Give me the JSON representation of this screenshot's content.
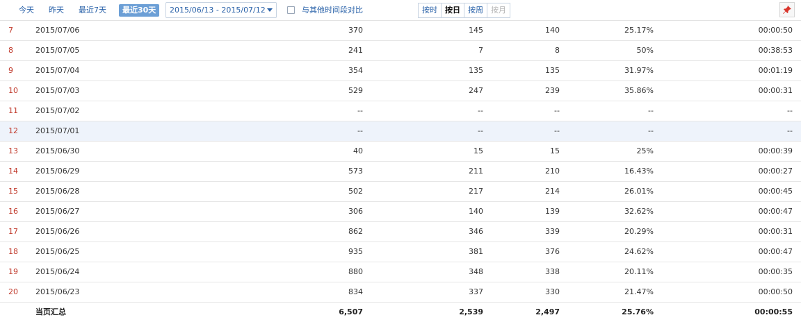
{
  "toolbar": {
    "today": "今天",
    "yesterday": "昨天",
    "last7": "最近7天",
    "last30": "最近30天",
    "date_range": "2015/06/13 - 2015/07/12",
    "compare_label": "与其他时间段对比",
    "compare_checked": false,
    "granularity": [
      "按时",
      "按日",
      "按周",
      "按月"
    ],
    "granularity_selected": "按日",
    "pin_icon": "pin-icon"
  },
  "table": {
    "rows": [
      {
        "idx": "7",
        "date": "2015/07/06",
        "pv": "370",
        "uv": "145",
        "ip": "140",
        "rate": "25.17%",
        "time": "00:00:50"
      },
      {
        "idx": "8",
        "date": "2015/07/05",
        "pv": "241",
        "uv": "7",
        "ip": "8",
        "rate": "50%",
        "time": "00:38:53"
      },
      {
        "idx": "9",
        "date": "2015/07/04",
        "pv": "354",
        "uv": "135",
        "ip": "135",
        "rate": "31.97%",
        "time": "00:01:19"
      },
      {
        "idx": "10",
        "date": "2015/07/03",
        "pv": "529",
        "uv": "247",
        "ip": "239",
        "rate": "35.86%",
        "time": "00:00:31"
      },
      {
        "idx": "11",
        "date": "2015/07/02",
        "pv": "--",
        "uv": "--",
        "ip": "--",
        "rate": "--",
        "time": "--"
      },
      {
        "idx": "12",
        "date": "2015/07/01",
        "pv": "--",
        "uv": "--",
        "ip": "--",
        "rate": "--",
        "time": "--"
      },
      {
        "idx": "13",
        "date": "2015/06/30",
        "pv": "40",
        "uv": "15",
        "ip": "15",
        "rate": "25%",
        "time": "00:00:39"
      },
      {
        "idx": "14",
        "date": "2015/06/29",
        "pv": "573",
        "uv": "211",
        "ip": "210",
        "rate": "16.43%",
        "time": "00:00:27"
      },
      {
        "idx": "15",
        "date": "2015/06/28",
        "pv": "502",
        "uv": "217",
        "ip": "214",
        "rate": "26.01%",
        "time": "00:00:45"
      },
      {
        "idx": "16",
        "date": "2015/06/27",
        "pv": "306",
        "uv": "140",
        "ip": "139",
        "rate": "32.62%",
        "time": "00:00:47"
      },
      {
        "idx": "17",
        "date": "2015/06/26",
        "pv": "862",
        "uv": "346",
        "ip": "339",
        "rate": "20.29%",
        "time": "00:00:31"
      },
      {
        "idx": "18",
        "date": "2015/06/25",
        "pv": "935",
        "uv": "381",
        "ip": "376",
        "rate": "24.62%",
        "time": "00:00:47"
      },
      {
        "idx": "19",
        "date": "2015/06/24",
        "pv": "880",
        "uv": "348",
        "ip": "338",
        "rate": "20.11%",
        "time": "00:00:35"
      },
      {
        "idx": "20",
        "date": "2015/06/23",
        "pv": "834",
        "uv": "337",
        "ip": "330",
        "rate": "21.47%",
        "time": "00:00:50"
      }
    ],
    "highlighted_row": "12",
    "total": {
      "label": "当页汇总",
      "pv": "6,507",
      "uv": "2,539",
      "ip": "2,497",
      "rate": "25.76%",
      "time": "00:00:55"
    }
  },
  "colors": {
    "link": "#2a62a9",
    "active_bg": "#6c9fd6",
    "index_red": "#c0392b",
    "highlight_row": "#eef3fb",
    "pin_red": "#d9342b"
  }
}
